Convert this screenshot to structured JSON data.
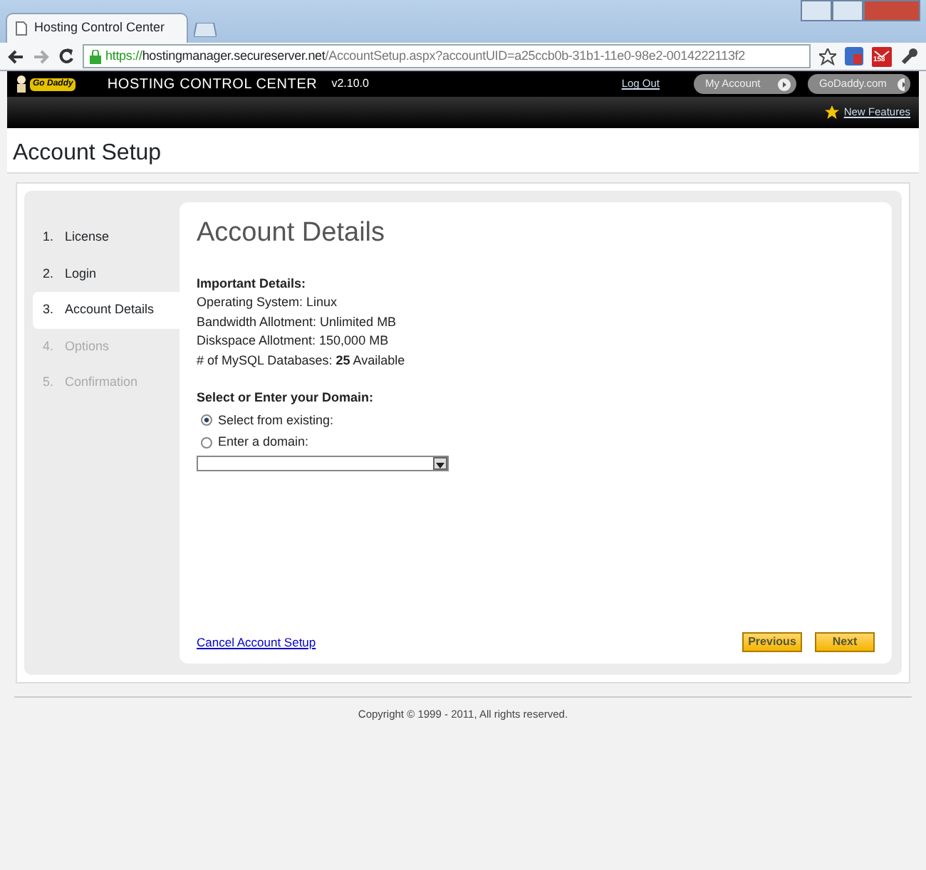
{
  "browser": {
    "tab_title": "Hosting Control Center",
    "url_secure": "https://",
    "url_host": "hostingmanager.secureserver.net",
    "url_path": "/AccountSetup.aspx?accountUID=a25ccb0b-31b1-11e0-98e2-0014222113f2",
    "mail_badge": "158"
  },
  "header": {
    "logo_text": "Go Daddy",
    "product": "HOSTING CONTROL CENTER",
    "version": "v2.10.0",
    "logout": "Log Out",
    "buttons": [
      "My Account",
      "GoDaddy.com"
    ],
    "new_features": "New Features"
  },
  "page_title": "Account Setup",
  "steps": [
    {
      "number": "1.",
      "label": "License",
      "selected": false,
      "disabled": false
    },
    {
      "number": "2.",
      "label": "Login",
      "selected": false,
      "disabled": false
    },
    {
      "number": "3.",
      "label": "Account Details",
      "selected": true,
      "disabled": false
    },
    {
      "number": "4.",
      "label": "Options",
      "selected": false,
      "disabled": true
    },
    {
      "number": "5.",
      "label": "Confirmation",
      "selected": false,
      "disabled": true
    }
  ],
  "heading": "Account Details",
  "details": {
    "title": "Important Details:",
    "lines": [
      "Operating System: Linux",
      "Bandwidth Allotment: Unlimited MB",
      "Diskspace Allotment: 150,000 MB",
      "# of MySQL Databases: **25** Available"
    ]
  },
  "domain": {
    "title": "Select or Enter your Domain:",
    "options": [
      {
        "label": "Select from existing:",
        "selected": true
      },
      {
        "label": "Enter a domain:",
        "selected": false
      }
    ]
  },
  "cancel": "Cancel Account Setup",
  "nav_buttons": [
    "Previous",
    "Next"
  ],
  "copyright": "Copyright © 1999 - 2011, All rights reserved."
}
